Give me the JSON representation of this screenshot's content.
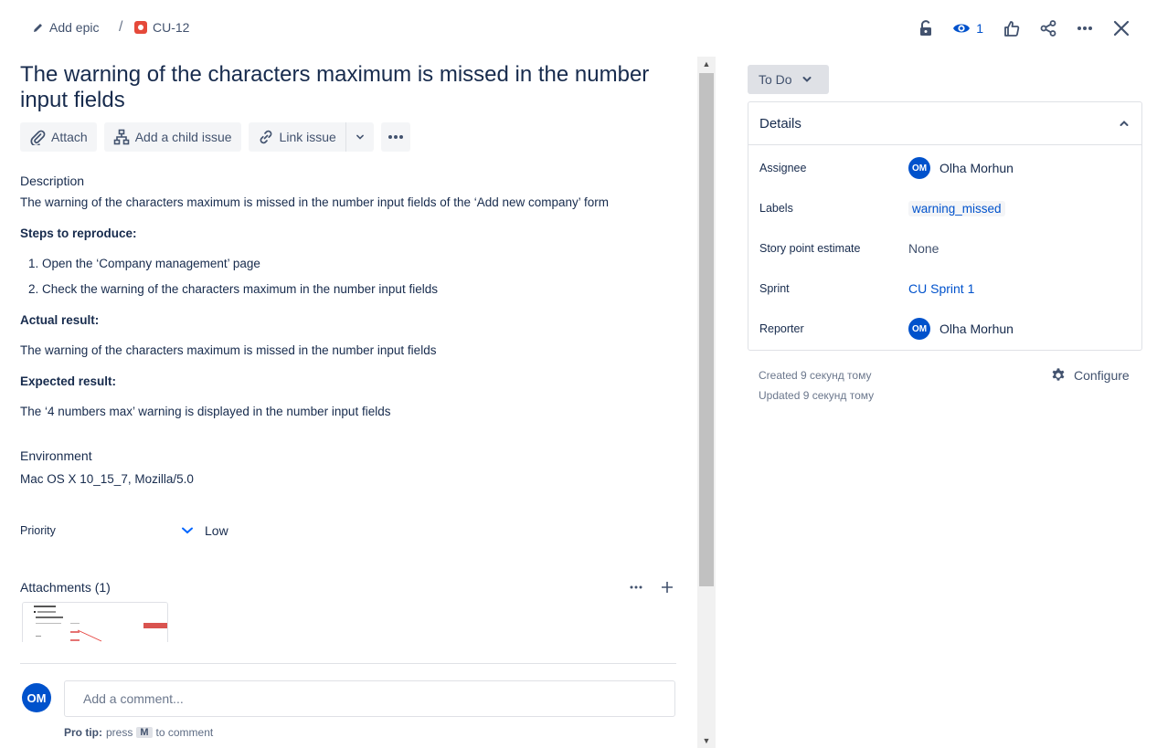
{
  "breadcrumb": {
    "epic_label": "Add epic",
    "separator": "/",
    "issue_key": "CU-12"
  },
  "top_actions": {
    "watch_count": "1",
    "icons": [
      "lock-icon",
      "eye-icon",
      "thumbs-up-icon",
      "share-icon",
      "more-icon",
      "close-icon"
    ]
  },
  "issue": {
    "title": "The warning of the characters maximum is missed in the number input fields"
  },
  "toolbar": {
    "attach": "Attach",
    "add_child": "Add a child issue",
    "link_issue": "Link issue"
  },
  "description": {
    "label": "Description",
    "text": "The  warning of the characters maximum is missed in the number input fields of the ‘Add new company’ form",
    "steps_heading": "Steps to reproduce:",
    "steps": [
      "Open the ‘Company management’ page",
      "Check the warning of the characters maximum in the number input fields"
    ],
    "actual_heading": "Actual result:",
    "actual_text": "The warning of the characters maximum is missed in the number input fields",
    "expected_heading": "Expected result:",
    "expected_text": "The ‘4 numbers max’ warning is displayed in the number input fields"
  },
  "environment": {
    "label": "Environment",
    "value": "Mac OS X 10_15_7, Mozilla/5.0"
  },
  "priority": {
    "label": "Priority",
    "value": "Low"
  },
  "attachments": {
    "label": "Attachments (1)"
  },
  "comment": {
    "avatar_initials": "OM",
    "placeholder": "Add a comment...",
    "protip_bold": "Pro tip:",
    "protip_press": "press",
    "protip_key": "M",
    "protip_rest": "to comment"
  },
  "status": {
    "label": "To Do"
  },
  "details": {
    "heading": "Details",
    "assignee_label": "Assignee",
    "assignee_initials": "OM",
    "assignee_name": "Olha Morhun",
    "labels_label": "Labels",
    "labels_value": "warning_missed",
    "story_points_label": "Story point estimate",
    "story_points_value": "None",
    "sprint_label": "Sprint",
    "sprint_value": "CU Sprint 1",
    "reporter_label": "Reporter",
    "reporter_initials": "OM",
    "reporter_name": "Olha Morhun"
  },
  "meta": {
    "created": "Created 9 секунд тому",
    "updated": "Updated 9 секунд тому",
    "configure": "Configure"
  },
  "colors": {
    "primary_text": "#172b4d",
    "link": "#0052cc",
    "avatar_bg": "#0052cc",
    "bug_red": "#e5493a",
    "button_bg": "#f4f5f7",
    "status_bg": "#dfe1e6"
  }
}
